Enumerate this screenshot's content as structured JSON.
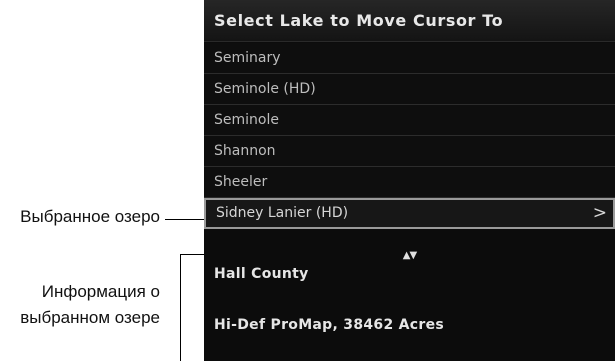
{
  "panel": {
    "title": "Select Lake to Move Cursor To",
    "lakes": [
      {
        "label": "Seminary"
      },
      {
        "label": "Seminole (HD)"
      },
      {
        "label": "Seminole"
      },
      {
        "label": "Shannon"
      },
      {
        "label": "Sheeler"
      },
      {
        "label": "Sidney Lanier (HD)",
        "selected": true
      }
    ],
    "chevron": ">",
    "scroll_arrows": "▲▼",
    "info": {
      "county": "Hall County",
      "detail": "Hi-Def ProMap, 38462 Acres"
    }
  },
  "callouts": {
    "selected_lake": "Выбранное озеро",
    "lake_info_line1": "Информация о",
    "lake_info_line2": "выбранном озере"
  },
  "icons": {
    "chevron": "chevron-right-icon",
    "scroll": "scroll-up-down-icon"
  },
  "colors": {
    "panel_bg": "#0c0c0c",
    "item_text": "#bdbdbd",
    "selected_border": "#9a9a9a",
    "info_text": "#e6e6e6"
  }
}
